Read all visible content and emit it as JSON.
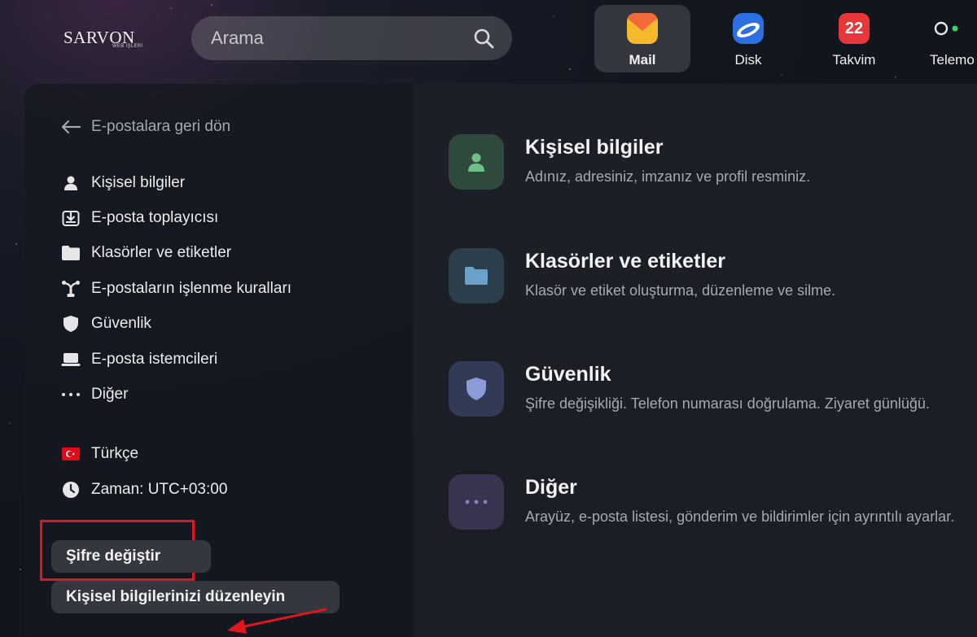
{
  "header": {
    "logo_text": "SARVON",
    "logo_sub": "WEB İŞLERİ",
    "search_placeholder": "Arama",
    "apps": [
      {
        "label": "Mail",
        "active": true
      },
      {
        "label": "Disk",
        "active": false
      },
      {
        "label": "Takvim",
        "active": false,
        "badge": "22"
      },
      {
        "label": "Telemo",
        "active": false
      }
    ]
  },
  "sidebar": {
    "back_label": "E-postalara geri dön",
    "items": [
      {
        "label": "Kişisel bilgiler",
        "icon": "person-icon"
      },
      {
        "label": "E-posta toplayıcısı",
        "icon": "download-tray-icon"
      },
      {
        "label": "Klasörler ve etiketler",
        "icon": "folder-icon"
      },
      {
        "label": "E-postaların işlenme kuralları",
        "icon": "filter-rules-icon"
      },
      {
        "label": "Güvenlik",
        "icon": "shield-icon"
      },
      {
        "label": "E-posta istemcileri",
        "icon": "laptop-icon"
      },
      {
        "label": "Diğer",
        "icon": "more-dots-icon"
      }
    ],
    "language": "Türkçe",
    "timezone": "Zaman: UTC+03:00",
    "change_password_label": "Şifre değiştir",
    "edit_info_label": "Kişisel bilgilerinizi düzenleyin"
  },
  "main": {
    "cards": [
      {
        "title": "Kişisel bilgiler",
        "desc": "Adınız, adresiniz, imzanız ve profil resminiz.",
        "icon": "person-icon",
        "color": "#2f4a3c"
      },
      {
        "title": "Klasörler ve etiketler",
        "desc": "Klasör ve etiket oluşturma, düzenleme ve silme.",
        "icon": "folder-icon",
        "color": "#2c3e4b"
      },
      {
        "title": "Güvenlik",
        "desc": "Şifre değişikliği. Telefon numarası doğrulama. Ziyaret günlüğü.",
        "icon": "shield-icon",
        "color": "#333a55"
      },
      {
        "title": "Diğer",
        "desc": "Arayüz, e-posta listesi, gönderim ve bildirimler için ayrıntılı ayarlar.",
        "icon": "more-dots-icon",
        "color": "#3a3350"
      }
    ]
  },
  "colors": {
    "highlight": "#e0151d",
    "accent_green": "#6fbf8a",
    "accent_blue": "#6aa2c9",
    "accent_indigo": "#8d9bd8",
    "accent_purple": "#8a7fc4"
  }
}
